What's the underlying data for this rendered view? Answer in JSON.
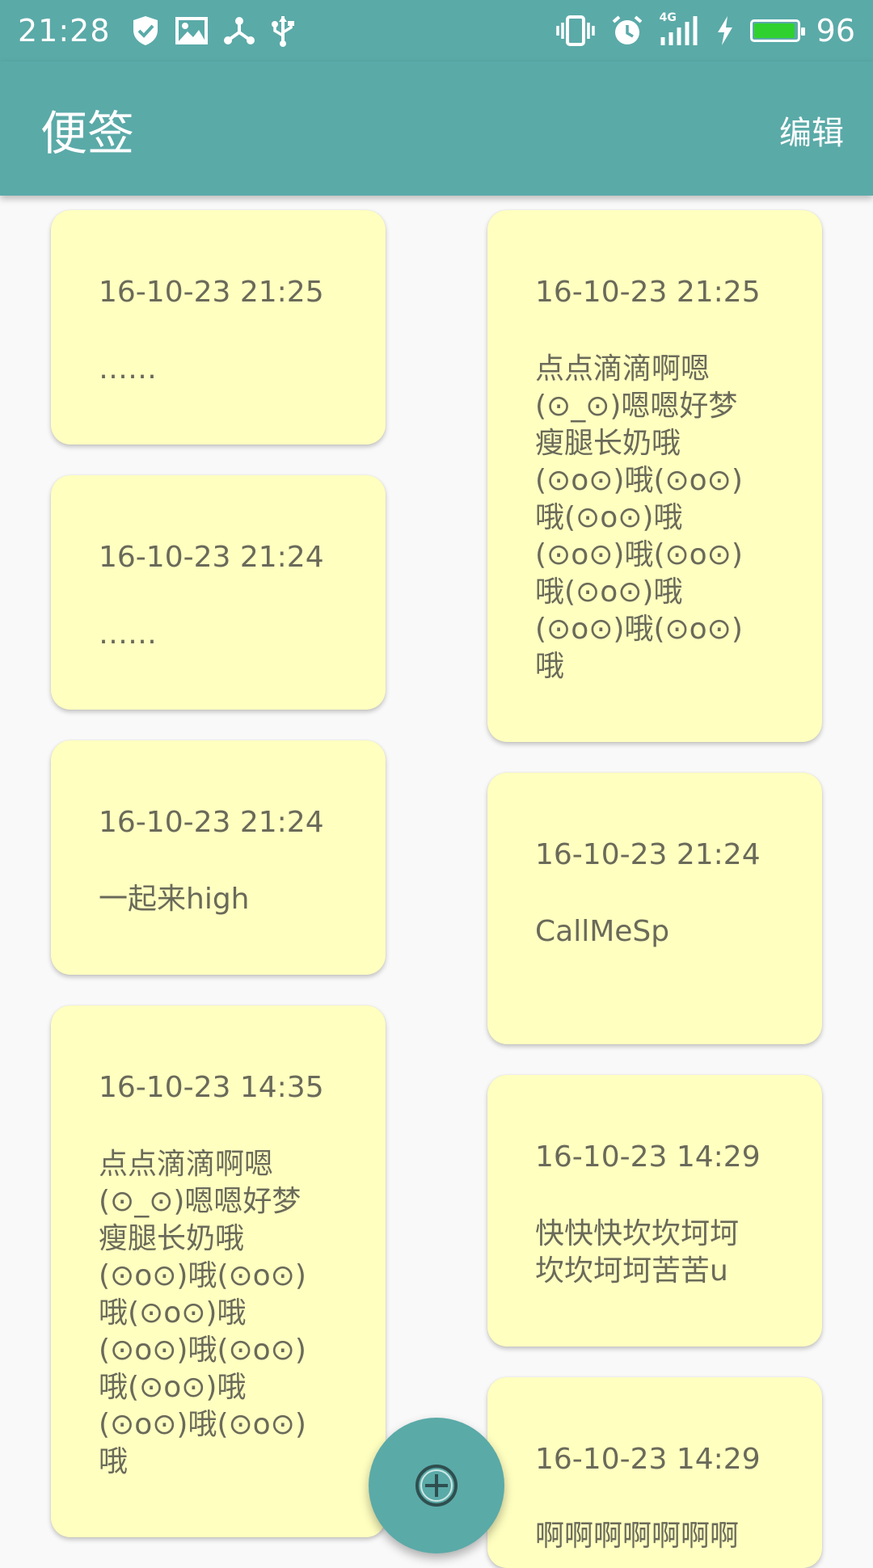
{
  "status_bar": {
    "time": "21:28",
    "network": "4G",
    "battery_percent": "96",
    "battery_level": 0.96,
    "left_icons": [
      "shield-check-icon",
      "image-icon",
      "share-node-icon",
      "usb-icon"
    ],
    "right_icons": [
      "vibrate-icon",
      "alarm-icon",
      "signal-icon",
      "charging-icon",
      "battery-icon"
    ]
  },
  "app_bar": {
    "title": "便签",
    "edit_label": "编辑"
  },
  "notes_left": [
    {
      "date": "16-10-23 21:25",
      "text": "……"
    },
    {
      "date": "16-10-23 21:24",
      "text": "……"
    },
    {
      "date": "16-10-23 21:24",
      "text": "一起来high"
    },
    {
      "date": "16-10-23 14:35",
      "text": "点点滴滴啊嗯\n(⊙_⊙)嗯嗯好梦\n瘦腿长奶哦\n(⊙o⊙)哦(⊙o⊙)\n哦(⊙o⊙)哦\n(⊙o⊙)哦(⊙o⊙)\n哦(⊙o⊙)哦\n(⊙o⊙)哦(⊙o⊙)\n哦"
    }
  ],
  "notes_right": [
    {
      "date": "16-10-23 21:25",
      "text": "点点滴滴啊嗯\n(⊙_⊙)嗯嗯好梦\n瘦腿长奶哦\n(⊙o⊙)哦(⊙o⊙)\n哦(⊙o⊙)哦\n(⊙o⊙)哦(⊙o⊙)\n哦(⊙o⊙)哦\n(⊙o⊙)哦(⊙o⊙)\n哦"
    },
    {
      "date": "16-10-23 21:24",
      "text": "CallMeSp"
    },
    {
      "date": "16-10-23 14:29",
      "text": "快快快坎坎坷坷\n坎坎坷坷苦苦u"
    },
    {
      "date": "16-10-23 14:29",
      "text": "啊啊啊啊啊啊啊"
    }
  ],
  "colors": {
    "primary": "#5aaaa8",
    "note_background": "#ffffc0",
    "note_text": "#6a6a5a",
    "battery_fill": "#2fd12f"
  },
  "fab": {
    "icon": "add-circle-icon"
  }
}
